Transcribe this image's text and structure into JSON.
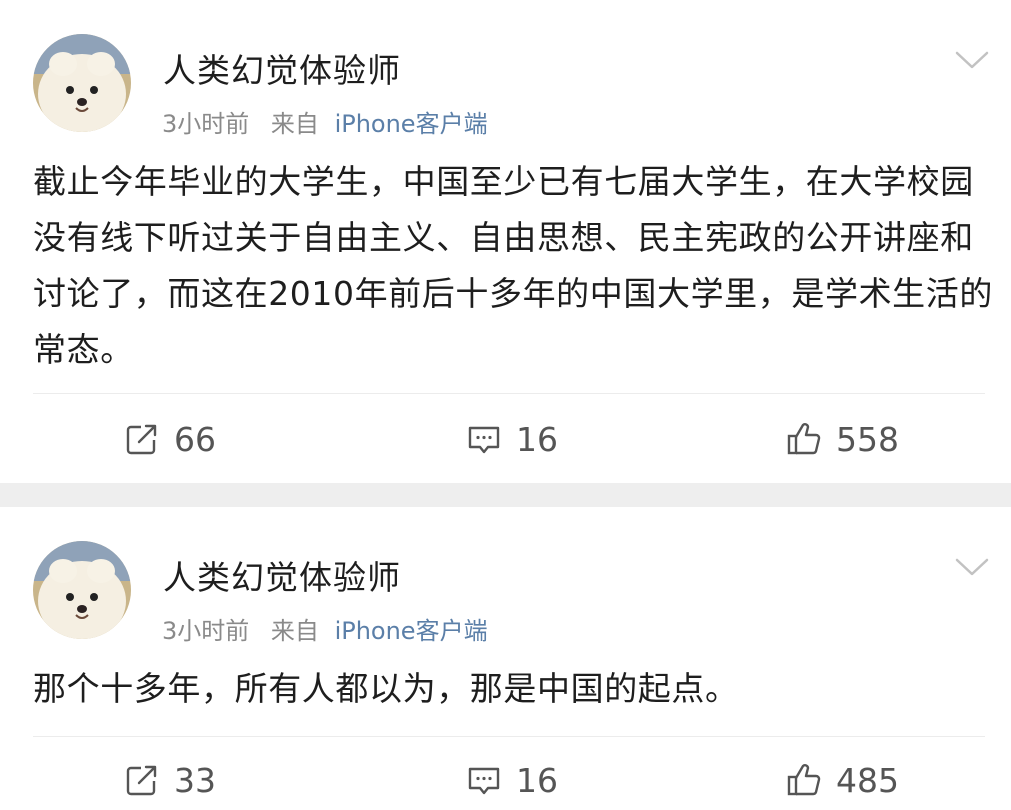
{
  "posts": [
    {
      "username": "人类幻觉体验师",
      "time": "3小时前",
      "source_prefix": "来自",
      "source": "iPhone客户端",
      "text": "截止今年毕业的大学生，中国至少已有七届大学生，在大学校园没有线下听过关于自由主义、自由思想、民主宪政的公开讲座和讨论了，而这在2010年前后十多年的中国大学里，是学术生活的常态。",
      "reposts": "66",
      "comments": "16",
      "likes": "558"
    },
    {
      "username": "人类幻觉体验师",
      "time": "3小时前",
      "source_prefix": "来自",
      "source": "iPhone客户端",
      "text": "那个十多年，所有人都以为，那是中国的起点。",
      "reposts": "33",
      "comments": "16",
      "likes": "485"
    }
  ],
  "icons": {
    "avatar": "pomeranian-dog-avatar",
    "menu": "chevron-down-icon",
    "repost": "repost-icon",
    "comment": "comment-icon",
    "like": "thumbs-up-icon"
  },
  "colors": {
    "text": "#1e1e1e",
    "meta": "#8a8a8a",
    "source_link": "#5b7fa8",
    "icon": "#555555",
    "separator": "#eeeeee"
  }
}
